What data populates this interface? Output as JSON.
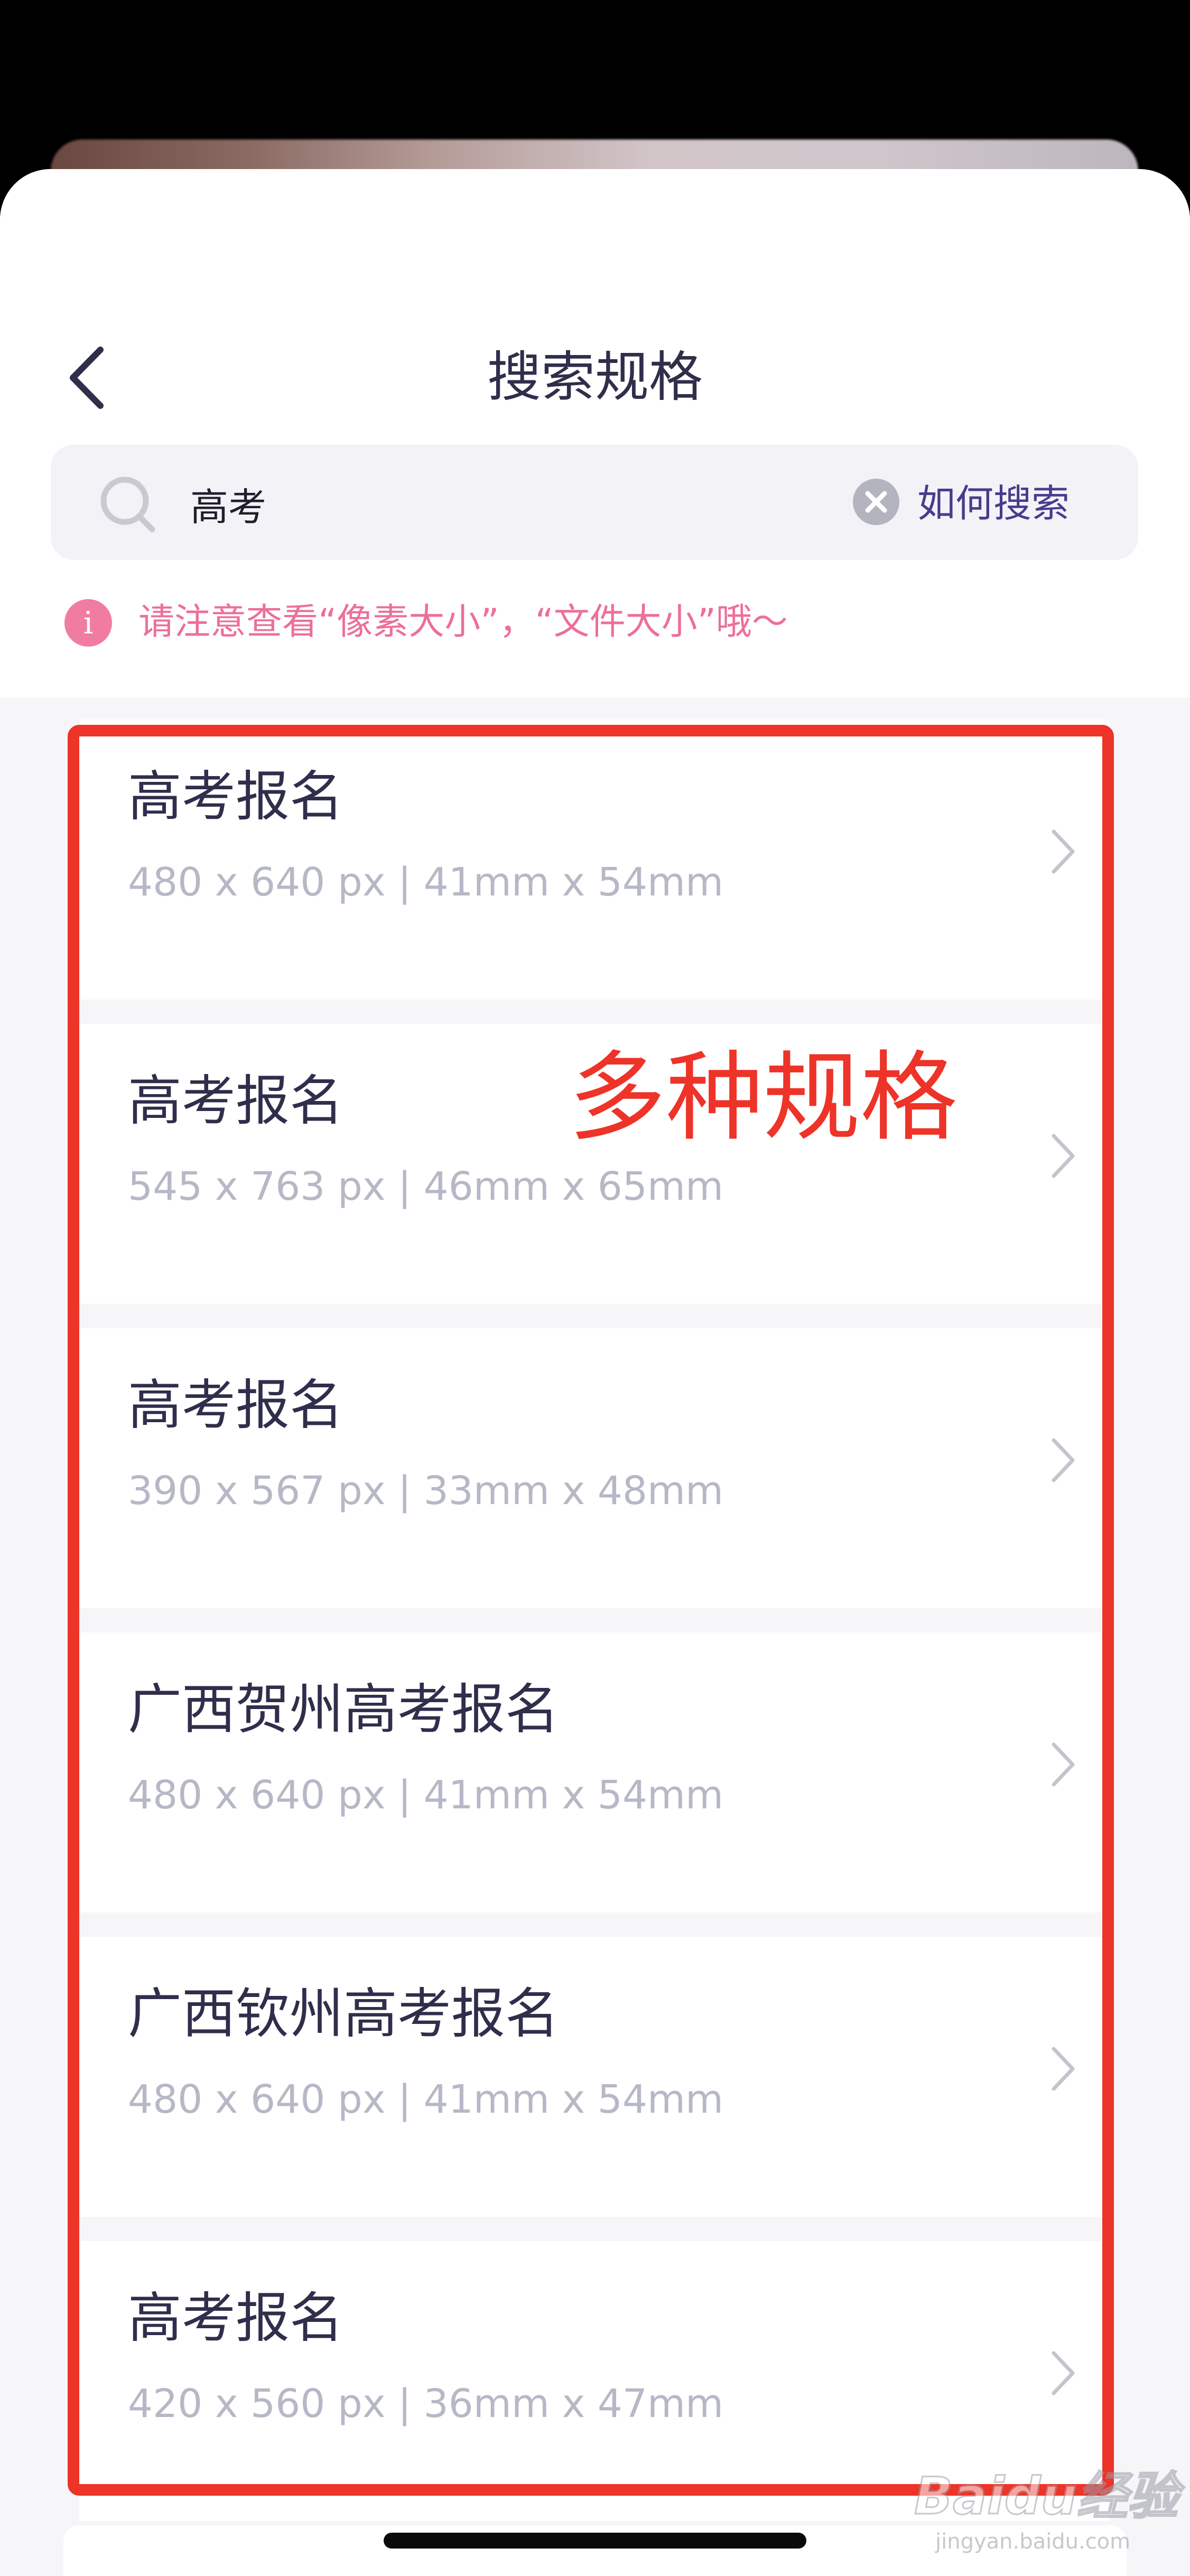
{
  "header": {
    "title": "搜索规格",
    "back_icon": "chevron-left-icon"
  },
  "search": {
    "value": "高考",
    "placeholder": "",
    "search_icon": "search-icon",
    "clear_icon": "clear-icon",
    "help_link": "如何搜索"
  },
  "notice": {
    "icon": "info-icon",
    "icon_glyph": "i",
    "text": "请注意查看“像素大小”，“文件大小”哦～"
  },
  "specs": [
    {
      "title": "高考报名",
      "detail": "480 x 640 px | 41mm x 54mm"
    },
    {
      "title": "高考报名",
      "detail": "545 x 763 px | 46mm x 65mm"
    },
    {
      "title": "高考报名",
      "detail": "390 x 567 px | 33mm x 48mm"
    },
    {
      "title": "广西贺州高考报名",
      "detail": "480 x 640 px | 41mm x 54mm"
    },
    {
      "title": "广西钦州高考报名",
      "detail": "480 x 640 px | 41mm x 54mm"
    },
    {
      "title": "高考报名",
      "detail": "420 x 560 px | 36mm x 47mm"
    }
  ],
  "annotation": {
    "text": "多种规格",
    "color": "#ee3328"
  },
  "watermark": {
    "text": "Baidu经验",
    "sub": "jingyan.baidu.com"
  },
  "colors": {
    "accent": "#4a3a8c",
    "notice": "#ec6f9a",
    "title_text": "#2f2e4b",
    "secondary_text": "#b6b8c6"
  }
}
